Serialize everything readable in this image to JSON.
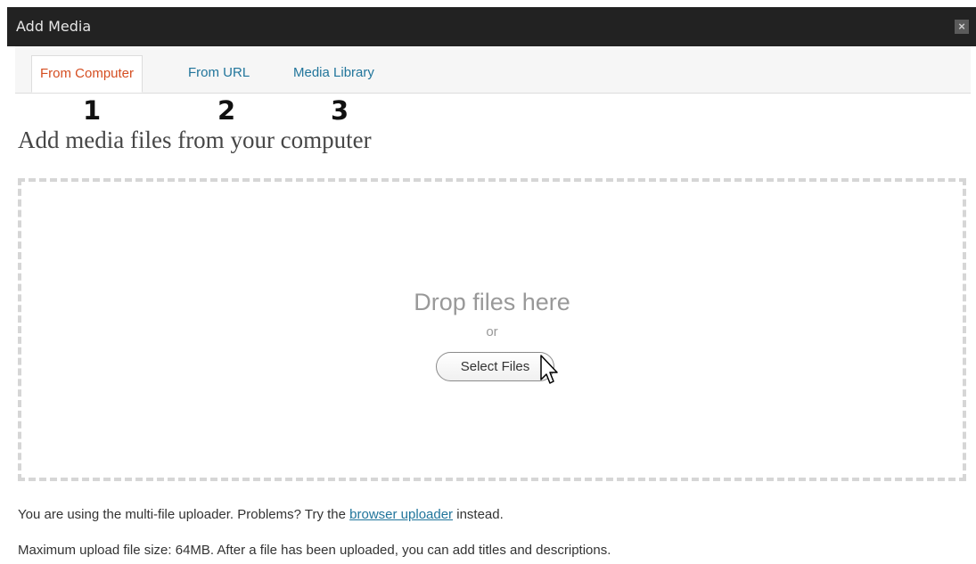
{
  "window": {
    "title": "Add Media",
    "close_symbol": "×"
  },
  "tabs": [
    {
      "label": "From Computer",
      "active": true
    },
    {
      "label": "From URL",
      "active": false
    },
    {
      "label": "Media Library",
      "active": false
    }
  ],
  "annotations": [
    "1",
    "2",
    "3"
  ],
  "heading": "Add media files from your computer",
  "dropzone": {
    "drop_text": "Drop files here",
    "or_text": "or",
    "button_label": "Select Files"
  },
  "notes": {
    "line1_before": "You are using the multi-file uploader. Problems? Try the ",
    "line1_link": "browser uploader",
    "line1_after": " instead.",
    "line2": "Maximum upload file size: 64MB. After a file has been uploaded, you can add titles and descriptions."
  },
  "colors": {
    "titlebar_bg": "#222222",
    "link": "#21759b",
    "active_tab": "#d54e21",
    "drop_border": "#d6d6d6"
  },
  "icons": [
    "close-icon",
    "mouse-pointer-icon"
  ]
}
